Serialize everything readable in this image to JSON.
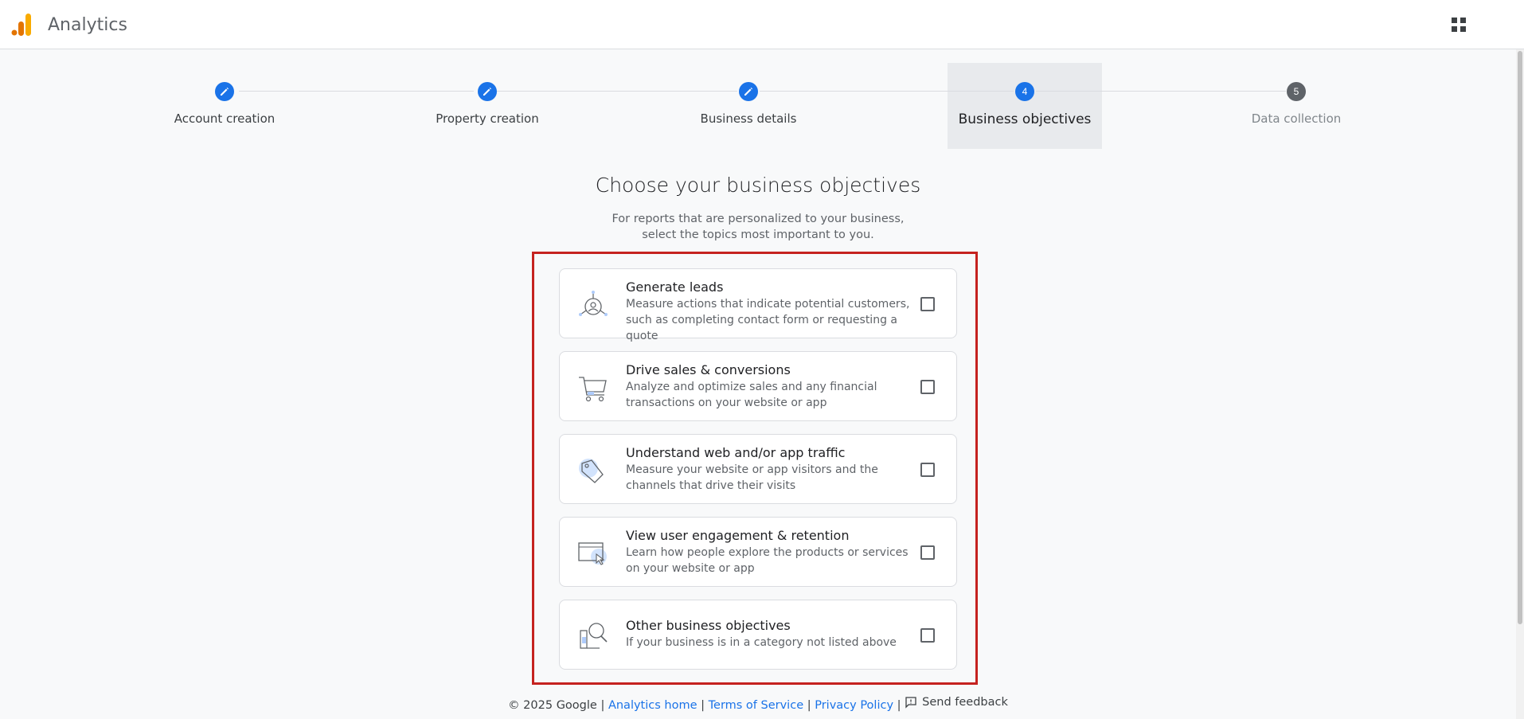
{
  "header": {
    "app_title": "Analytics",
    "logo_icon": "analytics-logo",
    "apps_icon": "apps-grid-icon"
  },
  "stepper": {
    "steps": [
      {
        "number": "1",
        "label": "Account creation",
        "state": "done"
      },
      {
        "number": "2",
        "label": "Property creation",
        "state": "done"
      },
      {
        "number": "3",
        "label": "Business details",
        "state": "done"
      },
      {
        "number": "4",
        "label": "Business objectives",
        "state": "current"
      },
      {
        "number": "5",
        "label": "Data collection",
        "state": "pending"
      }
    ]
  },
  "main": {
    "title": "Choose your business objectives",
    "subtitle_line1": "For reports that are personalized to your business,",
    "subtitle_line2": "select the topics most important to you.",
    "objectives": [
      {
        "title": "Generate leads",
        "desc": "Measure actions that indicate potential customers, such as completing contact form or requesting a quote",
        "checked": false,
        "icon": "leads-icon"
      },
      {
        "title": "Drive sales & conversions",
        "desc": "Analyze and optimize sales and any financial transactions on your website or app",
        "checked": false,
        "icon": "shopping-cart-icon"
      },
      {
        "title": "Understand web and/or app traffic",
        "desc": "Measure your website or app visitors and the channels that drive their visits",
        "checked": false,
        "icon": "tag-icon"
      },
      {
        "title": "View user engagement & retention",
        "desc": "Learn how people explore the products or services on your website or app",
        "checked": false,
        "icon": "browser-cursor-icon"
      },
      {
        "title": "Other business objectives",
        "desc": "If your business is in a category not listed above",
        "checked": false,
        "icon": "magnifier-icon"
      }
    ]
  },
  "footer": {
    "copyright": "© 2025 Google",
    "links": [
      "Analytics home",
      "Terms of Service",
      "Privacy Policy"
    ],
    "separator": "|",
    "feedback": "Send feedback"
  },
  "colors": {
    "accent": "#1a73e8",
    "highlight": "#c5221f",
    "logo_orange": "#f9ab00",
    "logo_dark_orange": "#e37400"
  }
}
